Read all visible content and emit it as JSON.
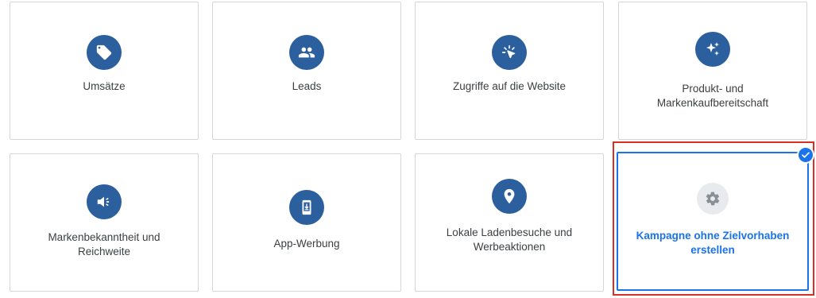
{
  "cards": [
    {
      "label": "Umsätze",
      "icon": "tag-icon"
    },
    {
      "label": "Leads",
      "icon": "people-icon"
    },
    {
      "label": "Zugriffe auf die Website",
      "icon": "cursor-click-icon"
    },
    {
      "label_line1": "Produkt- und",
      "label_line2": "Markenkaufbereitschaft",
      "icon": "sparkle-icon"
    },
    {
      "label_line1": "Markenbekanntheit und",
      "label_line2": "Reichweite",
      "icon": "megaphone-icon"
    },
    {
      "label": "App-Werbung",
      "icon": "phone-download-icon"
    },
    {
      "label_line1": "Lokale Ladenbesuche und",
      "label_line2": "Werbeaktionen",
      "icon": "location-pin-icon"
    },
    {
      "label_line1": "Kampagne ohne Zielvorhaben",
      "label_line2": "erstellen",
      "icon": "gear-icon",
      "selected": true
    }
  ],
  "colors": {
    "icon_bg": "#2b5f9e",
    "selected_accent": "#1a73e8",
    "highlight_red": "#d93025"
  }
}
